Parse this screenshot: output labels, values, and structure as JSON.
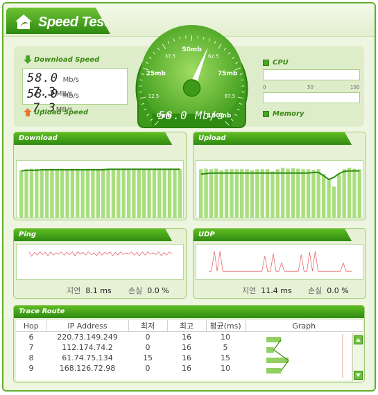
{
  "app": {
    "title": "Speed Test"
  },
  "download": {
    "label": "Download Speed",
    "value1": "58.0",
    "unit1": "Mb/s",
    "value2": "7.3",
    "unit2": "MB/s"
  },
  "upload": {
    "label": "Upload Speed",
    "value1": "58.0",
    "unit1": "Mb/s",
    "value2": "7.3",
    "unit2": "MB/s"
  },
  "gauge": {
    "ticks": [
      "0mb",
      "12.5",
      "25mb",
      "37.5",
      "50mb",
      "62.5",
      "75mb",
      "87.5",
      "100mb"
    ],
    "reading": "58.0 Mb/s",
    "value": 58.0,
    "max": 100
  },
  "cpu": {
    "label": "CPU",
    "scale": [
      "0",
      "50",
      "100"
    ],
    "level": 0
  },
  "memory": {
    "label": "Memory",
    "level": 0
  },
  "panels": {
    "download": {
      "title": "Download"
    },
    "upload": {
      "title": "Upload"
    },
    "ping": {
      "title": "Ping",
      "delay_label": "지연",
      "delay_value": "8.1 ms",
      "loss_label": "손실",
      "loss_value": "0.0 %"
    },
    "udp": {
      "title": "UDP",
      "delay_label": "지연",
      "delay_value": "11.4 ms",
      "loss_label": "손실",
      "loss_value": "0.0 %"
    }
  },
  "trace": {
    "title": "Trace Route",
    "columns": [
      "Hop",
      "IP Address",
      "최저",
      "최고",
      "평균(ms)",
      "Graph"
    ],
    "rows": [
      {
        "hop": "6",
        "ip": "220.73.149.249",
        "min": "0",
        "max": "16",
        "avg": "10"
      },
      {
        "hop": "7",
        "ip": "112.174.74.2",
        "min": "0",
        "max": "16",
        "avg": "5"
      },
      {
        "hop": "8",
        "ip": "61.74.75.134",
        "min": "15",
        "max": "16",
        "avg": "15"
      },
      {
        "hop": "9",
        "ip": "168.126.72.98",
        "min": "0",
        "max": "16",
        "avg": "10"
      }
    ]
  },
  "chart_data": [
    {
      "type": "bar",
      "name": "download",
      "values": [
        90,
        92,
        93,
        93,
        91,
        92,
        93,
        93,
        93,
        92,
        93,
        93,
        92,
        93,
        93,
        92,
        93,
        93,
        92,
        92,
        93,
        93,
        93,
        93,
        93,
        92,
        93,
        92,
        93,
        93,
        92,
        92
      ],
      "line": [
        89,
        90,
        90,
        90,
        91,
        91,
        91,
        91,
        91,
        91,
        91,
        91,
        91,
        91,
        91,
        91,
        91,
        92,
        92,
        92,
        92,
        92,
        92,
        92,
        92,
        92,
        92,
        92,
        92,
        92,
        92,
        92
      ]
    },
    {
      "type": "bar",
      "name": "upload",
      "values": [
        92,
        93,
        92,
        93,
        90,
        92,
        92,
        92,
        92,
        92,
        90,
        92,
        92,
        92,
        88,
        92,
        95,
        93,
        94,
        93,
        92,
        92,
        91,
        92,
        83,
        72,
        60,
        83,
        92,
        95,
        93,
        92
      ],
      "line": [
        83,
        84,
        85,
        85,
        85,
        85,
        85,
        85,
        85,
        85,
        85,
        85,
        85,
        85,
        85,
        85,
        85,
        85,
        85,
        85,
        85,
        85,
        86,
        86,
        80,
        73,
        77,
        84,
        88,
        89,
        89,
        89
      ]
    },
    {
      "type": "line",
      "name": "ping",
      "values": [
        60,
        20,
        55,
        30,
        60,
        35,
        55,
        25,
        60,
        30,
        50,
        40,
        60,
        30,
        55,
        35,
        60,
        25,
        60,
        40,
        55,
        30,
        60,
        35,
        50,
        25,
        60,
        30,
        55,
        40,
        60,
        25,
        55,
        30,
        60,
        35,
        50,
        40,
        60,
        30,
        55,
        25,
        60,
        30,
        60,
        40,
        50,
        35,
        60,
        25,
        55,
        30,
        60,
        40
      ]
    },
    {
      "type": "line",
      "name": "udp",
      "values": [
        5,
        5,
        90,
        5,
        90,
        5,
        5,
        5,
        5,
        5,
        5,
        5,
        5,
        5,
        5,
        5,
        5,
        5,
        5,
        5,
        70,
        5,
        5,
        80,
        5,
        5,
        40,
        5,
        5,
        5,
        5,
        5,
        5,
        75,
        5,
        5,
        85,
        5,
        90,
        5,
        5,
        5,
        5,
        5,
        5,
        5,
        5,
        5,
        40,
        5,
        5,
        5
      ]
    }
  ]
}
